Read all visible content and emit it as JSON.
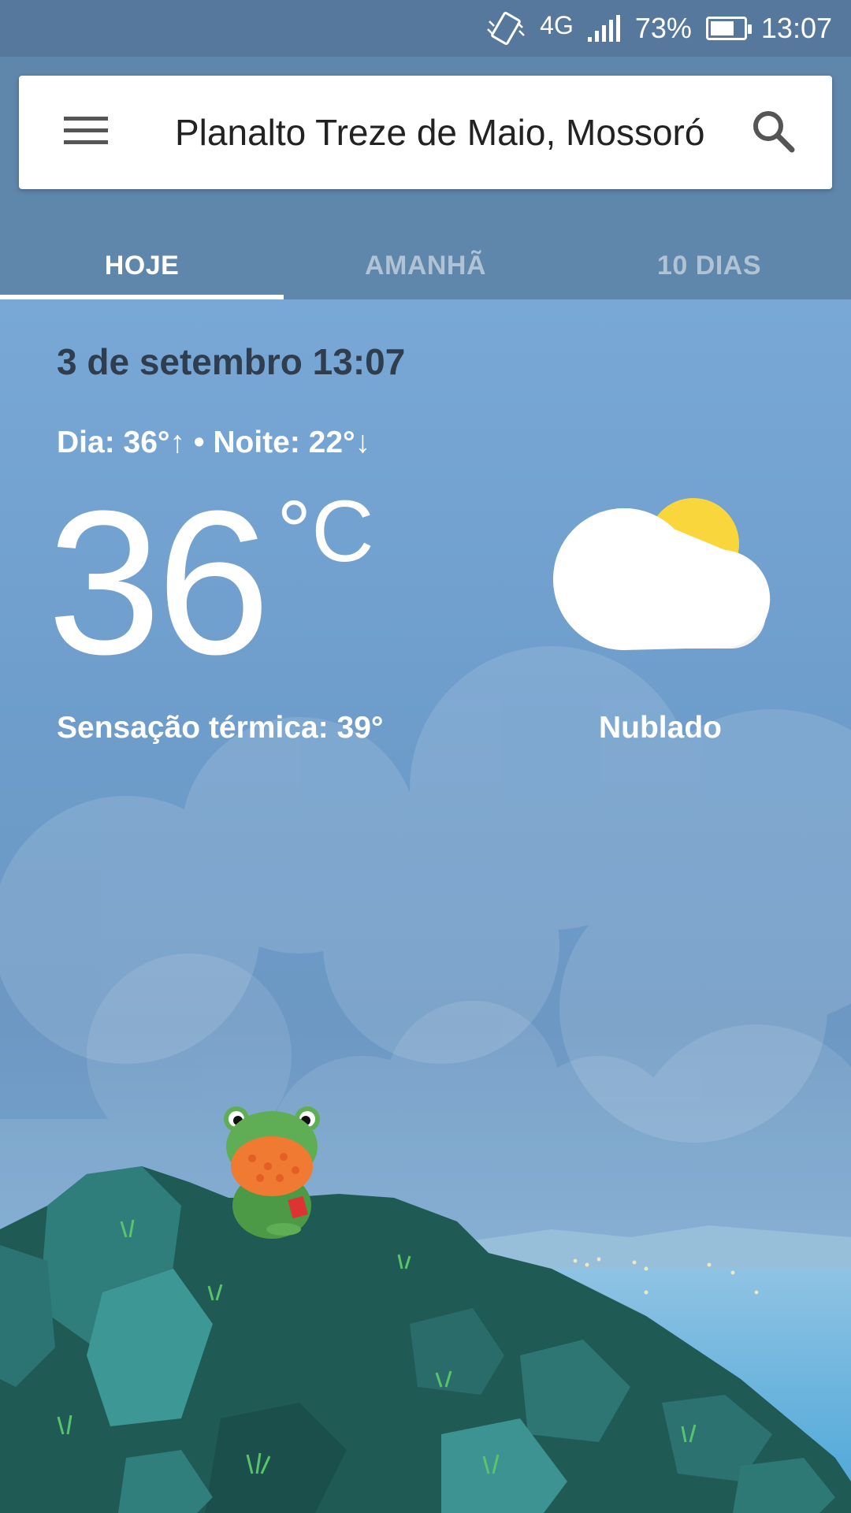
{
  "status_bar": {
    "network": "4G",
    "battery_percent": "73%",
    "battery_level": 0.73,
    "time": "13:07",
    "icons": [
      "vibrate-icon",
      "signal-icon",
      "battery-icon"
    ]
  },
  "search": {
    "location": "Planalto Treze de Maio, Mossoró",
    "menu_icon": "menu-icon",
    "search_icon": "search-icon"
  },
  "tabs": [
    {
      "label": "HOJE",
      "active": true
    },
    {
      "label": "AMANHÃ",
      "active": false
    },
    {
      "label": "10 DIAS",
      "active": false
    }
  ],
  "weather": {
    "date": "3 de setembro 13:07",
    "day_night": "Dia: 36°↑ • Noite: 22°↓",
    "temperature": "36",
    "unit": "°C",
    "feels_like": "Sensação térmica: 39°",
    "condition": "Nublado",
    "condition_icon": "partly-cloudy-icon"
  },
  "colors": {
    "header": "#5f86ab",
    "status_bar": "#56789c",
    "sky": "#79a8d6",
    "sun": "#f9d63c"
  }
}
